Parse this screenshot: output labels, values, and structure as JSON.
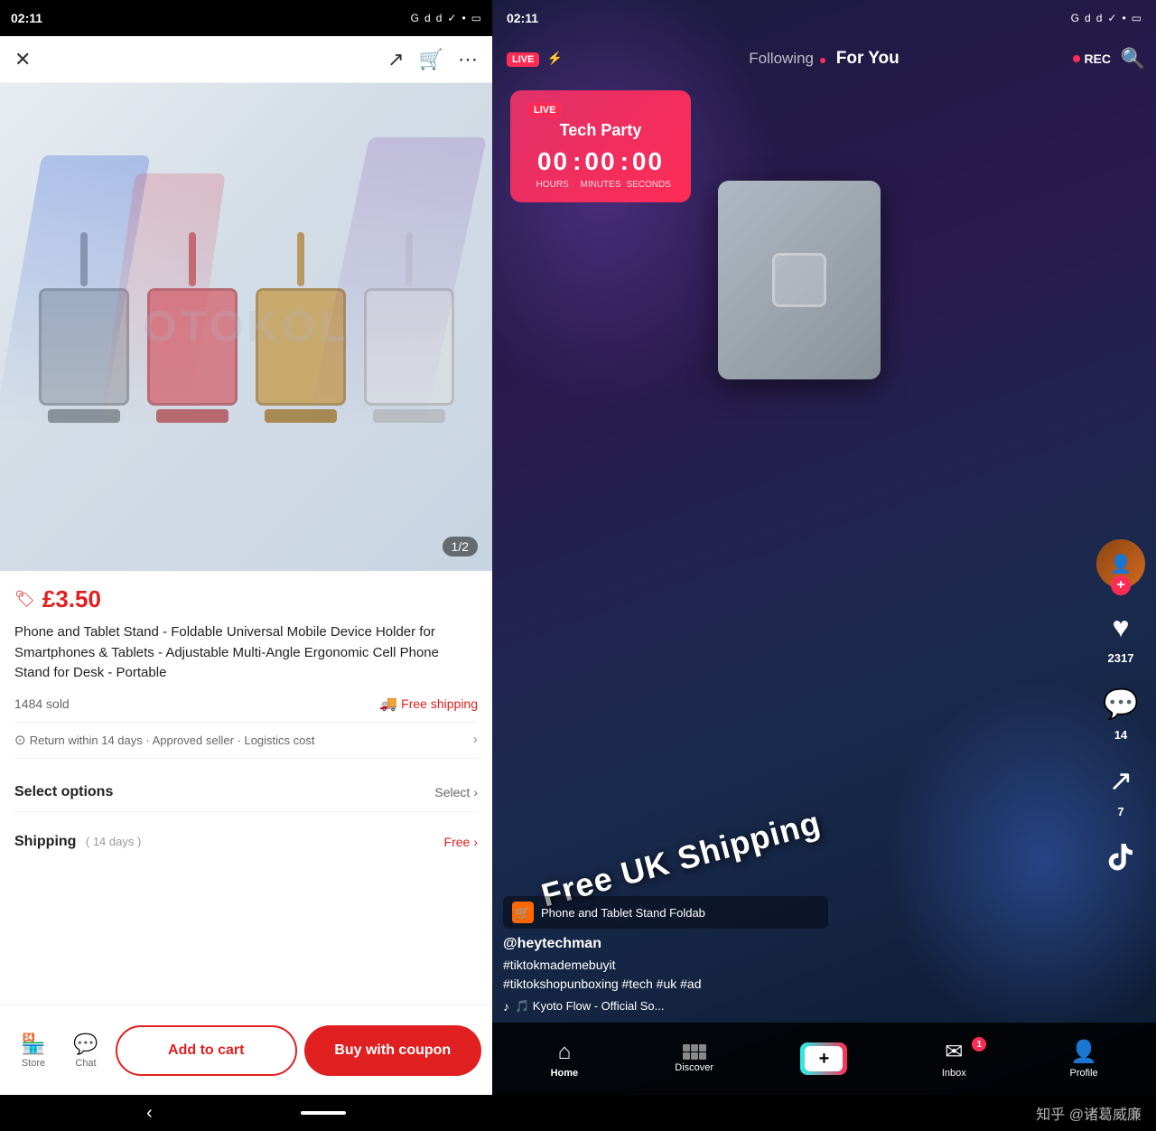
{
  "left": {
    "statusTime": "02:11",
    "statusIcons": [
      "G",
      "d",
      "d",
      "✓",
      "•"
    ],
    "nav": {
      "close": "✕",
      "share": "↗",
      "cart": "🛒",
      "more": "⋯"
    },
    "imageCounter": "1/2",
    "watermark": "OTOKOL",
    "price": "£3.50",
    "priceIcon": "🏷",
    "title": "Phone and Tablet Stand - Foldable Universal Mobile Device Holder for Smartphones & Tablets - Adjustable Multi-Angle Ergonomic Cell Phone Stand for Desk - Portable",
    "soldCount": "1484 sold",
    "freeShipping": "Free shipping",
    "returns": {
      "text": "Return within 14 days · Approved seller · Logistics cost",
      "arrow": "›"
    },
    "selectOptions": {
      "label": "Select options",
      "action": "Select",
      "arrow": "›"
    },
    "shipping": {
      "label": "Shipping",
      "days": "( 14 days )",
      "value": "Free",
      "arrow": "›"
    },
    "bottomBar": {
      "storeLabel": "Store",
      "chatLabel": "Chat",
      "addToCart": "Add to cart",
      "buyWithCoupon": "Buy with coupon"
    },
    "sysNav": {
      "back": "‹",
      "home": ""
    }
  },
  "right": {
    "statusTime": "02:11",
    "statusIcons": [
      "G",
      "d",
      "d",
      "✓",
      "•"
    ],
    "nav": {
      "following": "Following",
      "forYou": "For You",
      "rec": "REC",
      "search": "🔍"
    },
    "techParty": {
      "liveBadge": "LIVE",
      "title": "Tech Party",
      "hours": "00",
      "minutes": "00",
      "seconds": "00",
      "hoursLabel": "HOURS",
      "minutesLabel": "MINUTES",
      "secondsLabel": "SECONDS"
    },
    "freeShippingText": "Free UK Shipping",
    "productTag": {
      "name": "Phone and Tablet Stand  Foldab"
    },
    "username": "@heytechman",
    "hashtags": "#tiktokmademebuyit\n#tiktokshopunboxing #tech #uk #ad",
    "music": "🎵  Kyoto Flow - Official So...",
    "actions": {
      "likes": "2317",
      "comments": "14",
      "shares": "7"
    },
    "bottomNav": {
      "homeLabel": "Home",
      "discoverLabel": "Discover",
      "addLabel": "+",
      "inboxLabel": "Inbox",
      "profileLabel": "Profile",
      "inboxBadge": "1"
    },
    "watermark": "知乎 @诸葛威廉"
  }
}
